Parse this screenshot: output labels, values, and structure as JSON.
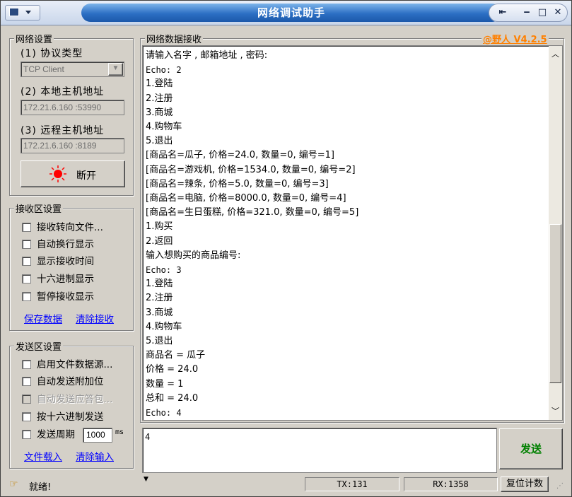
{
  "title": "网络调试助手",
  "brand": "@野人 V4.2.5",
  "network_settings": {
    "group_label": "网络设置",
    "protocol_label": "(1) 协议类型",
    "protocol_value": "TCP Client",
    "local_label": "(2) 本地主机地址",
    "local_value": "172.21.6.160 :53990",
    "remote_label": "(3) 远程主机地址",
    "remote_value": "172.21.6.160 :8189",
    "disconnect_label": "断开",
    "status_color": "#ff0000"
  },
  "receive_settings": {
    "group_label": "接收区设置",
    "options": [
      {
        "label": "接收转向文件...",
        "checked": false,
        "disabled": false
      },
      {
        "label": "自动换行显示",
        "checked": false,
        "disabled": false
      },
      {
        "label": "显示接收时间",
        "checked": false,
        "disabled": false
      },
      {
        "label": "十六进制显示",
        "checked": false,
        "disabled": false
      },
      {
        "label": "暂停接收显示",
        "checked": false,
        "disabled": false
      }
    ],
    "save_link": "保存数据",
    "clear_link": "清除接收"
  },
  "send_settings": {
    "group_label": "发送区设置",
    "options": [
      {
        "label": "启用文件数据源...",
        "checked": false,
        "disabled": false
      },
      {
        "label": "自动发送附加位",
        "checked": false,
        "disabled": false
      },
      {
        "label": "自动发送应答包...",
        "checked": false,
        "disabled": true
      },
      {
        "label": "按十六进制发送",
        "checked": false,
        "disabled": false
      },
      {
        "label": "发送周期",
        "checked": false,
        "disabled": false
      }
    ],
    "period_value": "1000",
    "period_unit": "ms",
    "load_link": "文件载入",
    "clear_link": "清除输入"
  },
  "receive_area": {
    "group_label": "网络数据接收",
    "lines": [
      "请输入名字 , 邮箱地址 , 密码:",
      "Echo: 2",
      "1.登陆",
      "2.注册",
      "3.商城",
      "4.购物车",
      "5.退出",
      "[商品名=瓜子, 价格=24.0, 数量=0, 编号=1]",
      "[商品名=游戏机, 价格=1534.0, 数量=0, 编号=2]",
      "[商品名=辣条, 价格=5.0, 数量=0, 编号=3]",
      "[商品名=电脑, 价格=8000.0, 数量=0, 编号=4]",
      "[商品名=生日蛋糕, 价格=321.0, 数量=0, 编号=5]",
      "1.购买",
      "2.返回",
      "输入想购买的商品编号:",
      "Echo: 3",
      "1.登陆",
      "2.注册",
      "3.商城",
      "4.购物车",
      "5.退出",
      "商品名 = 瓜子",
      "价格 = 24.0",
      "数量 = 1",
      "总和 = 24.0",
      "Echo: 4"
    ]
  },
  "send_area": {
    "value": "4",
    "send_button": "发送"
  },
  "status_bar": {
    "ready": "就绪!",
    "tx": "TX:131",
    "rx": "RX:1358",
    "reset": "复位计数"
  }
}
